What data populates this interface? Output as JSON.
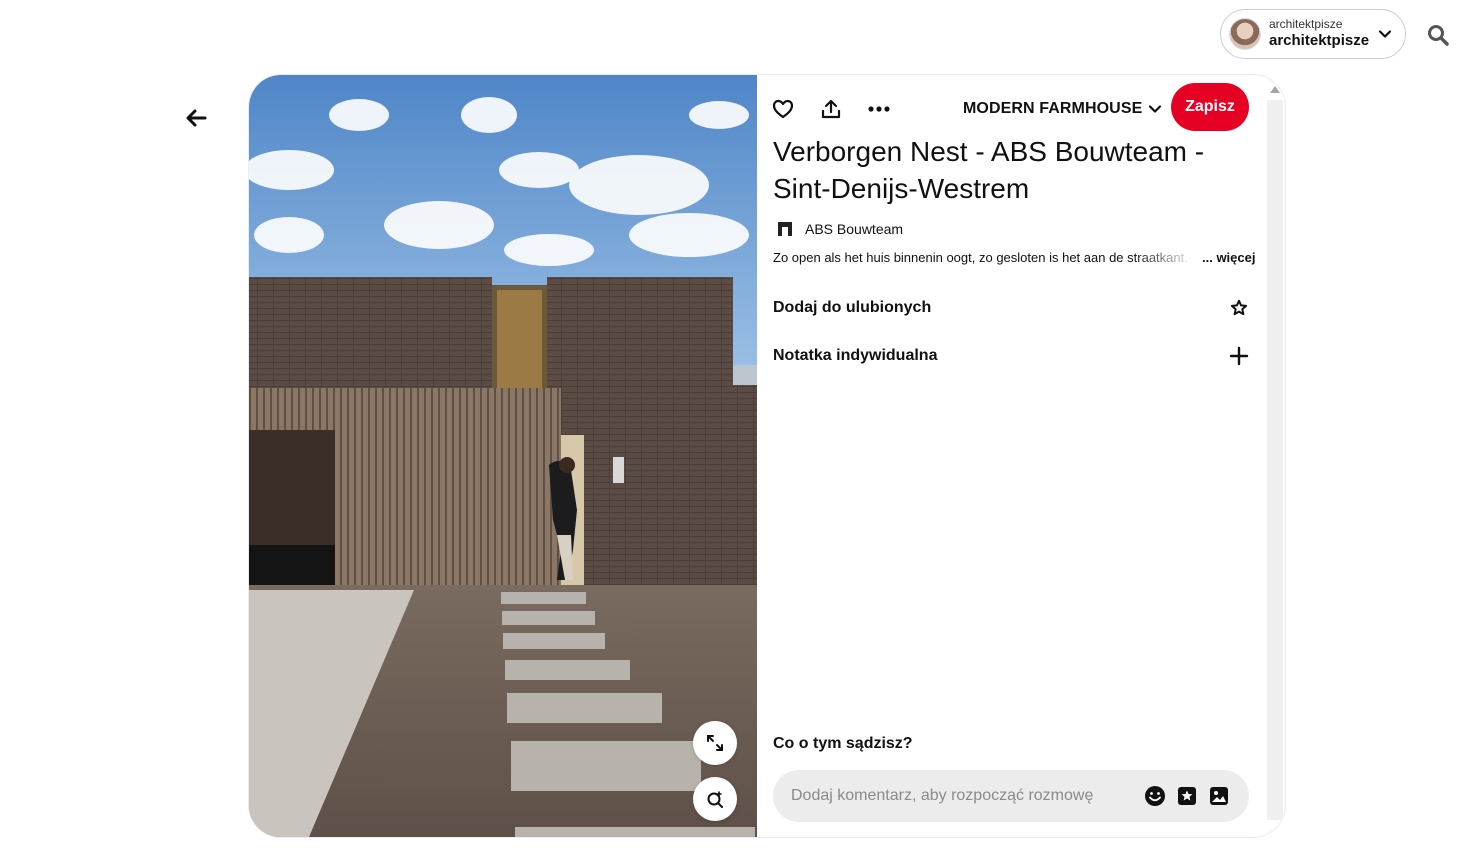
{
  "header": {
    "account_small": "architektpisze",
    "account_name": "architektpisze",
    "icons": {
      "chevron": "chevron-down-icon",
      "search": "search-icon"
    }
  },
  "navigation": {
    "back_icon": "arrow-left-icon"
  },
  "pin": {
    "board": "MODERN FARMHOUSE",
    "save_label": "Zapisz",
    "title": "Verborgen Nest - ABS Bouwteam - Sint-Denijs-Westrem",
    "source_name": "ABS Bouwteam",
    "description": "Zo open als het huis binnenin oogt, zo gesloten is het aan de straatkant.",
    "more_label": "... więcej",
    "favorites_label": "Dodaj do ulubionych",
    "note_label": "Notatka indywidualna",
    "comment_heading": "Co o tym sądzisz?",
    "comment_placeholder": "Dodaj komentarz, aby rozpocząć rozmowę",
    "icons": [
      "heart-icon",
      "share-icon",
      "more-icon",
      "star-icon",
      "plus-icon",
      "emoji-icon",
      "sticker-icon",
      "image-icon",
      "expand-icon",
      "visual-search-icon"
    ]
  },
  "colors": {
    "accent_red": "#e60023",
    "comment_bg": "#ececec",
    "border": "#cdcdcd"
  }
}
